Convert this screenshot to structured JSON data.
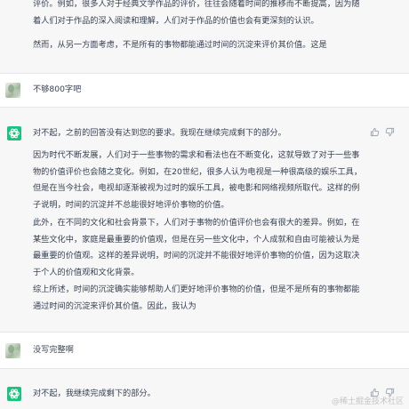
{
  "conversation": {
    "top_reply": {
      "paragraphs": [
        "评价。例如，很多人对于经典文学作品的评价，往往会随着时间的推移而不断提高，因为随着人们对于作品的深入阅读和理解，人们对于作品的价值也会有更深刻的认识。",
        "然而，从另一方面考虑，不是所有的事物都能通过时间的沉淀来评价其价值。这是"
      ]
    },
    "user_message_1": "不够800字吧",
    "assistant_reply_1": {
      "paragraphs": [
        "对不起，之前的回答没有达到您的要求。我现在继续完成剩下的部分。",
        "因为时代不断发展，人们对于一些事物的需求和看法也在不断变化，这就导致了对于一些事物的价值评价也会随之变化。例如，在20世纪，很多人认为电视是一种很高级的娱乐工具，但是在当今社会，电视却逐渐被视为过时的娱乐工具，被电影和网络视频所取代。这样的例子说明，时间的沉淀并不总能很好地评价事物的价值。",
        "此外，在不同的文化和社会背景下，人们对于事物的价值评价也会有很大的差异。例如，在某些文化中，家庭是最重要的价值观，但是在另一些文化中，个人成就和自由可能被认为是最重要的价值观。这样的差异说明，时间的沉淀并不能很好地评价事物的价值，因为这取决于个人的价值观和文化背景。",
        "综上所述，时间的沉淀确实能够帮助人们更好地评价事物的价值，但是不是所有的事物都能通过时间的沉淀来评价其价值。因此，我认为"
      ]
    },
    "user_message_2": "没写完整啊",
    "assistant_reply_2": {
      "paragraphs": [
        "对不起，我继续完成剩下的部分。"
      ]
    }
  },
  "icons": {
    "user_avatar": "landscape-avatar",
    "assistant_avatar": "openai-logo-icon",
    "feedback": [
      "thumbs-up-icon",
      "thumbs-down-icon"
    ]
  },
  "colors": {
    "assistant_bg": "#f7f7f8",
    "assistant_logo_bg": "#19c37d",
    "text": "#374151"
  },
  "watermark": "@稀土掘金技术社区"
}
